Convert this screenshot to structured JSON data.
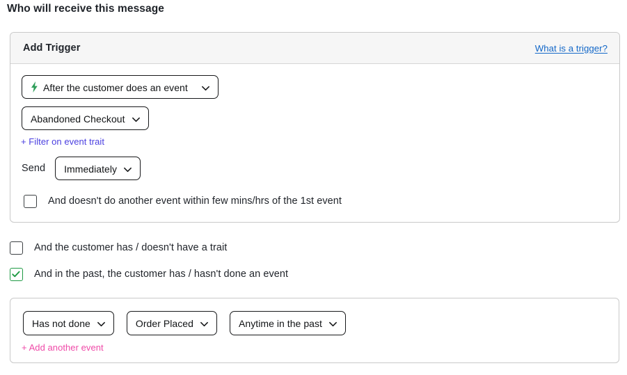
{
  "page": {
    "title": "Who will receive this message"
  },
  "trigger_panel": {
    "header": {
      "title": "Add Trigger",
      "help_link": "What is a trigger?",
      "help_link_color": "#1267c8"
    },
    "trigger_type": {
      "label": "After the customer does an event",
      "icon": "lightning-bolt-icon",
      "icon_color": "#2f9e5a",
      "chevron": "chevron-down-icon"
    },
    "event_name": {
      "label": "Abandoned Checkout",
      "chevron": "chevron-down-icon"
    },
    "filter_link": {
      "label": "+ Filter on event trait",
      "color": "#4a3fe0"
    },
    "send_row": {
      "label": "Send",
      "value": "Immediately",
      "chevron": "chevron-down-icon"
    },
    "no_other_event": {
      "label": "And doesn't do another event within few mins/hrs of the 1st event",
      "checked": false
    }
  },
  "conditions": [
    {
      "label": "And the customer has / doesn't have a trait",
      "checked": false
    },
    {
      "label": "And in the past, the customer has / hasn't done an event",
      "checked": true,
      "checked_color": "#1f9a44"
    }
  ],
  "past_event_panel": {
    "selectors": [
      {
        "label": "Has not done",
        "chevron": "chevron-down-icon"
      },
      {
        "label": "Order Placed",
        "chevron": "chevron-down-icon"
      },
      {
        "label": "Anytime in the past",
        "chevron": "chevron-down-icon"
      }
    ],
    "add_link": {
      "label": "+ Add another event",
      "color": "#ef4aa8"
    }
  }
}
